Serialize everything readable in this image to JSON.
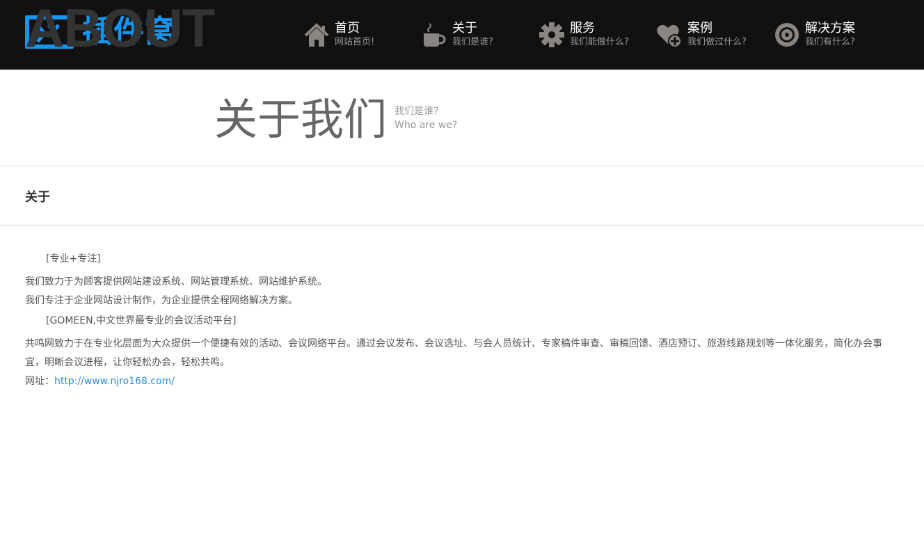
{
  "header": {
    "logo_text": "插件窝",
    "nav": [
      {
        "title": "首页",
        "sub": "网站首页!",
        "icon": "home-icon"
      },
      {
        "title": "关于",
        "sub": "我们是谁?",
        "icon": "coffee-cup-icon"
      },
      {
        "title": "服务",
        "sub": "我们能做什么?",
        "icon": "gear-icon"
      },
      {
        "title": "案例",
        "sub": "我们做过什么?",
        "icon": "heart-plus-icon"
      },
      {
        "title": "解决方案",
        "sub": "我们有什么?",
        "icon": "target-icon"
      }
    ]
  },
  "banner": {
    "title_en": "ABOUT",
    "title_cn": "关于我们",
    "sub_cn": "我们是谁?",
    "sub_en": "Who are we?"
  },
  "section": {
    "title": "关于"
  },
  "content": {
    "p1": "[专业+专注]",
    "p2": "我们致力于为顾客提供网站建设系统、网站管理系统、网站维护系统。",
    "p3": "我们专注于企业网站设计制作，为企业提供全程网络解决方案。",
    "p4": "[GOMEEN,中文世界最专业的会议活动平台]",
    "p5": "共鸣网致力于在专业化层面为大众提供一个便捷有效的活动、会议网络平台。通过会议发布、会议选址、与会人员统计、专家稿件审查、审稿回馈、酒店预订、旅游线路规划等一体化服务，简化办会事宜，明晰会议进程，让你轻松办会，轻松共鸣。",
    "url_label": "网址：",
    "url": "http://www.njro168.com/"
  },
  "colors": {
    "accent": "#1496f0",
    "header_bg": "#111111",
    "link": "#2b8ae0"
  }
}
